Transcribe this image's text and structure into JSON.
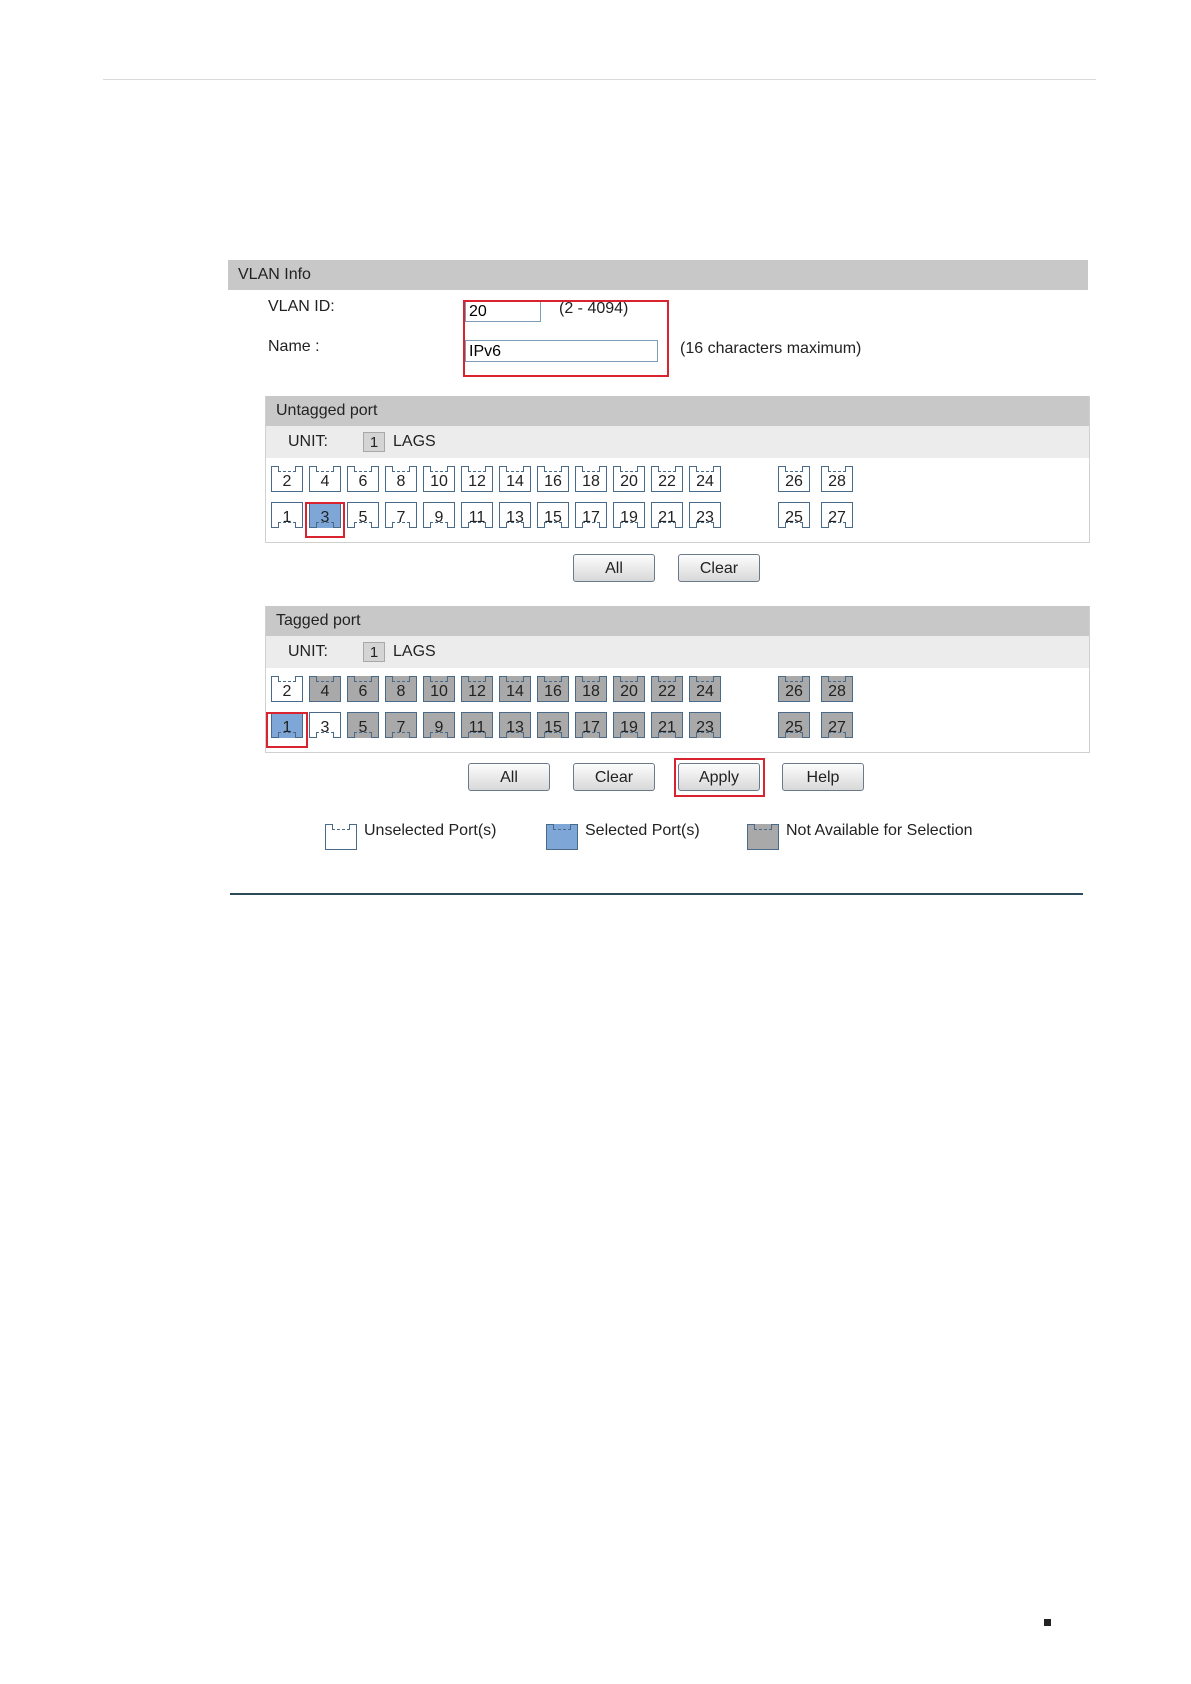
{
  "vlan_info": {
    "header": "VLAN Info",
    "vlan_id_label": "VLAN ID:",
    "vlan_id_value": "20",
    "vlan_id_hint": "(2 - 4094)",
    "name_label": "Name :",
    "name_value": "IPv6",
    "name_hint": "(16 characters maximum)"
  },
  "untagged": {
    "header": "Untagged port",
    "unit_label": "UNIT:",
    "unit_value": "1",
    "lags_label": "LAGS",
    "top_row": [
      {
        "label": "2",
        "state": "unselected"
      },
      {
        "label": "4",
        "state": "unselected"
      },
      {
        "label": "6",
        "state": "unselected"
      },
      {
        "label": "8",
        "state": "unselected"
      },
      {
        "label": "10",
        "state": "unselected"
      },
      {
        "label": "12",
        "state": "unselected"
      },
      {
        "label": "14",
        "state": "unselected"
      },
      {
        "label": "16",
        "state": "unselected"
      },
      {
        "label": "18",
        "state": "unselected"
      },
      {
        "label": "20",
        "state": "unselected"
      },
      {
        "label": "22",
        "state": "unselected"
      },
      {
        "label": "24",
        "state": "unselected"
      },
      {
        "label": "26",
        "state": "unselected"
      },
      {
        "label": "28",
        "state": "unselected"
      }
    ],
    "bottom_row": [
      {
        "label": "1",
        "state": "unselected"
      },
      {
        "label": "3",
        "state": "selected"
      },
      {
        "label": "5",
        "state": "unselected"
      },
      {
        "label": "7",
        "state": "unselected"
      },
      {
        "label": "9",
        "state": "unselected"
      },
      {
        "label": "11",
        "state": "unselected"
      },
      {
        "label": "13",
        "state": "unselected"
      },
      {
        "label": "15",
        "state": "unselected"
      },
      {
        "label": "17",
        "state": "unselected"
      },
      {
        "label": "19",
        "state": "unselected"
      },
      {
        "label": "21",
        "state": "unselected"
      },
      {
        "label": "23",
        "state": "unselected"
      },
      {
        "label": "25",
        "state": "unselected"
      },
      {
        "label": "27",
        "state": "unselected"
      }
    ],
    "buttons": {
      "all": "All",
      "clear": "Clear"
    }
  },
  "tagged": {
    "header": "Tagged port",
    "unit_label": "UNIT:",
    "unit_value": "1",
    "lags_label": "LAGS",
    "top_row": [
      {
        "label": "2",
        "state": "unselected"
      },
      {
        "label": "4",
        "state": "unavailable"
      },
      {
        "label": "6",
        "state": "unavailable"
      },
      {
        "label": "8",
        "state": "unavailable"
      },
      {
        "label": "10",
        "state": "unavailable"
      },
      {
        "label": "12",
        "state": "unavailable"
      },
      {
        "label": "14",
        "state": "unavailable"
      },
      {
        "label": "16",
        "state": "unavailable"
      },
      {
        "label": "18",
        "state": "unavailable"
      },
      {
        "label": "20",
        "state": "unavailable"
      },
      {
        "label": "22",
        "state": "unavailable"
      },
      {
        "label": "24",
        "state": "unavailable"
      },
      {
        "label": "26",
        "state": "unavailable"
      },
      {
        "label": "28",
        "state": "unavailable"
      }
    ],
    "bottom_row": [
      {
        "label": "1",
        "state": "selected"
      },
      {
        "label": "3",
        "state": "unselected"
      },
      {
        "label": "5",
        "state": "unavailable"
      },
      {
        "label": "7",
        "state": "unavailable"
      },
      {
        "label": "9",
        "state": "unavailable"
      },
      {
        "label": "11",
        "state": "unavailable"
      },
      {
        "label": "13",
        "state": "unavailable"
      },
      {
        "label": "15",
        "state": "unavailable"
      },
      {
        "label": "17",
        "state": "unavailable"
      },
      {
        "label": "19",
        "state": "unavailable"
      },
      {
        "label": "21",
        "state": "unavailable"
      },
      {
        "label": "23",
        "state": "unavailable"
      },
      {
        "label": "25",
        "state": "unavailable"
      },
      {
        "label": "27",
        "state": "unavailable"
      }
    ],
    "buttons": {
      "all": "All",
      "clear": "Clear",
      "apply": "Apply",
      "help": "Help"
    }
  },
  "legend": {
    "unselected": "Unselected Port(s)",
    "selected": "Selected Port(s)",
    "unavailable": "Not Available for Selection"
  },
  "colors": {
    "selected": "#7ea7d8",
    "unavailable": "#a9a9a9",
    "highlight": "#d9232e"
  }
}
